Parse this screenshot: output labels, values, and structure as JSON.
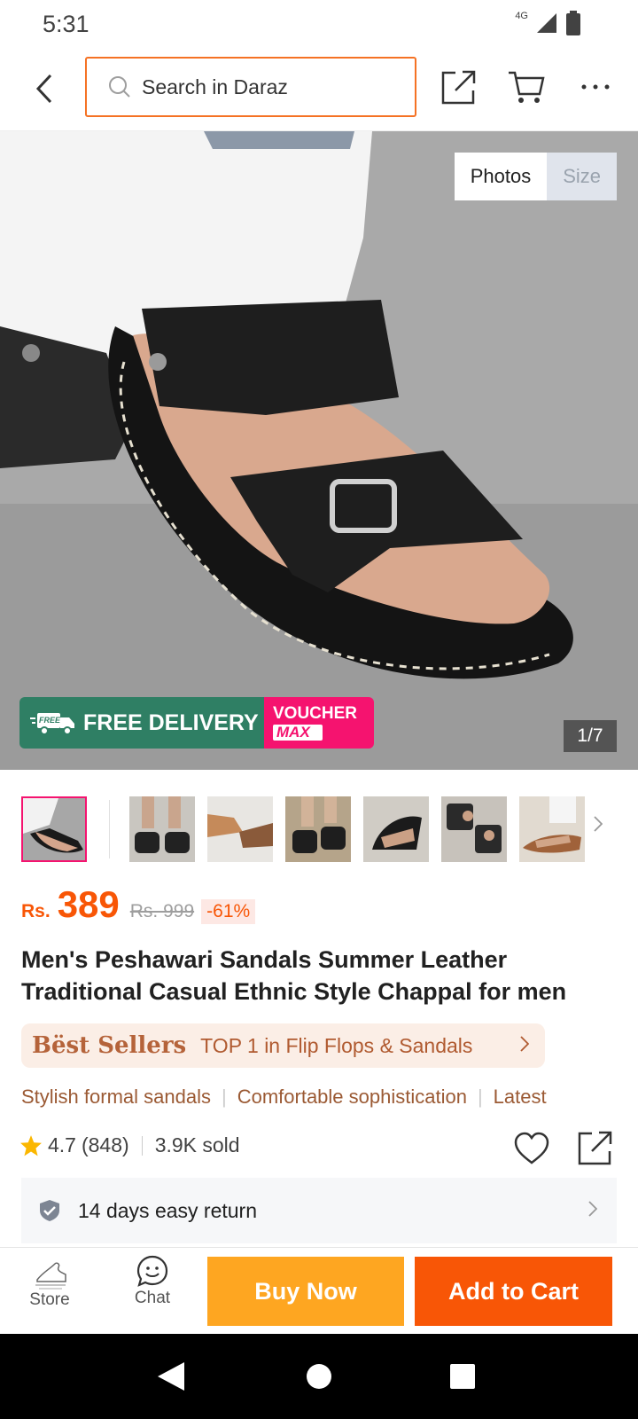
{
  "status_bar": {
    "time": "5:31",
    "network": "4G"
  },
  "search": {
    "placeholder": "Search in Daraz"
  },
  "gallery": {
    "toggle": {
      "photos": "Photos",
      "size": "Size"
    },
    "counter": "1/7",
    "promo": {
      "free_delivery": "FREE DELIVERY",
      "free_tag": "FREE",
      "voucher": "VOUCHER",
      "max": "MAX"
    }
  },
  "product": {
    "currency": "Rs.",
    "price": "389",
    "old_price": "Rs. 999",
    "discount": "-61%",
    "title": "Men's Peshawari Sandals Summer Leather Traditional Casual Ethnic Style Chappal for men",
    "best_sellers": {
      "label": "Bëst Sellers",
      "text": "TOP 1 in Flip Flops & Sandals"
    },
    "tags": [
      "Stylish formal sandals",
      "Comfortable sophistication",
      "Latest"
    ],
    "rating": "4.7",
    "reviews": "(848)",
    "sold": "3.9K sold",
    "return_policy": "14 days easy return"
  },
  "actions": {
    "store": "Store",
    "chat": "Chat",
    "buy_now": "Buy Now",
    "add_to_cart": "Add to Cart"
  },
  "colors": {
    "accent": "#f85606",
    "buy": "#fea621",
    "voucher": "#f5136f",
    "delivery": "#2f7f64"
  }
}
